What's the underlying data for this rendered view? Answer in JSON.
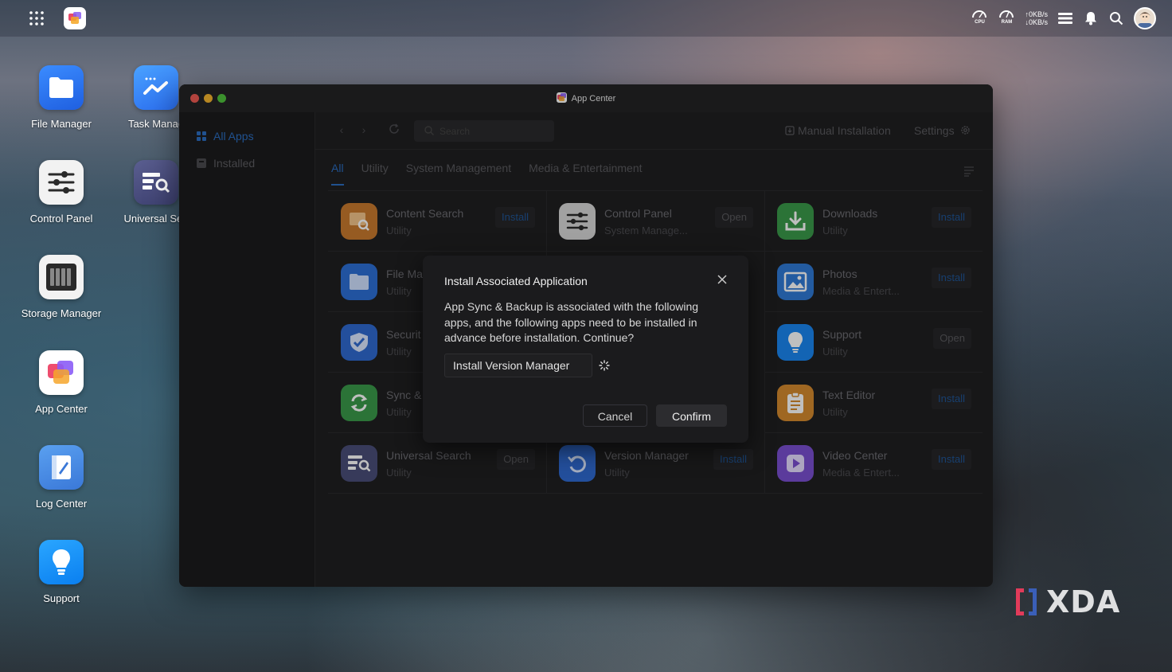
{
  "topbar": {
    "cpu_label": "CPU",
    "ram_label": "RAM",
    "upload_speed": "↑0KB/s",
    "download_speed": "↓0KB/s"
  },
  "desktop": {
    "icons": [
      {
        "label": "File Manager"
      },
      {
        "label": "Task Manag"
      },
      {
        "label": "Control Panel"
      },
      {
        "label": "Universal Sea"
      },
      {
        "label": "Storage Manager"
      },
      {
        "label": "App Center"
      },
      {
        "label": "Log Center"
      },
      {
        "label": "Support"
      }
    ]
  },
  "window": {
    "title": "App Center",
    "sidebar": {
      "items": [
        {
          "label": "All Apps",
          "active": true
        },
        {
          "label": "Installed",
          "active": false
        }
      ]
    },
    "toolbar": {
      "search_placeholder": "Search",
      "manual_installation": "Manual Installation",
      "settings": "Settings"
    },
    "tabs": [
      {
        "label": "All",
        "active": true
      },
      {
        "label": "Utility"
      },
      {
        "label": "System Management"
      },
      {
        "label": "Media & Entertainment"
      }
    ],
    "apps": [
      {
        "name": "Content Search",
        "category": "Utility",
        "action": "Install",
        "icon": "content-search-icon",
        "color": "#c97a2e"
      },
      {
        "name": "Control Panel",
        "category": "System Manage...",
        "action": "Open",
        "icon": "sliders-icon",
        "color": "#d7d7d7"
      },
      {
        "name": "Downloads",
        "category": "Utility",
        "action": "Install",
        "icon": "download-icon",
        "color": "#3a9a4a"
      },
      {
        "name": "File Ma",
        "category": "Utility",
        "action": "",
        "icon": "folder-icon",
        "color": "#2d6fd6"
      },
      {
        "name": "",
        "category": "",
        "action": "",
        "icon": "",
        "color": ""
      },
      {
        "name": "Photos",
        "category": "Media & Entert...",
        "action": "Install",
        "icon": "photo-icon",
        "color": "#2f7ad6"
      },
      {
        "name": "Securit",
        "category": "Utility",
        "action": "",
        "icon": "shield-icon",
        "color": "#2f6ad0"
      },
      {
        "name": "",
        "category": "",
        "action": "",
        "icon": "",
        "color": ""
      },
      {
        "name": "Support",
        "category": "Utility",
        "action": "Open",
        "icon": "lightbulb-icon",
        "color": "#1a86f0"
      },
      {
        "name": "Sync &",
        "category": "Utility",
        "action": "",
        "icon": "sync-icon",
        "color": "#3a9a4a"
      },
      {
        "name": "",
        "category": "",
        "action": "",
        "icon": "",
        "color": ""
      },
      {
        "name": "Text Editor",
        "category": "Utility",
        "action": "Install",
        "icon": "notepad-icon",
        "color": "#d48a2e"
      },
      {
        "name": "Universal Search",
        "category": "Utility",
        "action": "Open",
        "icon": "universal-search-icon",
        "color": "#4a4e78"
      },
      {
        "name": "Version Manager",
        "category": "Utility",
        "action": "Install",
        "icon": "version-icon",
        "color": "#2f6ad0"
      },
      {
        "name": "Video Center",
        "category": "Media & Entert...",
        "action": "Install",
        "icon": "play-icon",
        "color": "#7a4fd0"
      }
    ]
  },
  "dialog": {
    "title": "Install Associated Application",
    "message": "App Sync & Backup is associated with the following apps, and the following apps need to be installed in advance before installation. Continue?",
    "item": "Install Version Manager",
    "cancel": "Cancel",
    "confirm": "Confirm"
  },
  "watermark": {
    "text": "XDA"
  },
  "colors": {
    "accent": "#2b6dbf",
    "dialog_bg": "#1b1b1d",
    "window_bg": "#1f1f21"
  }
}
